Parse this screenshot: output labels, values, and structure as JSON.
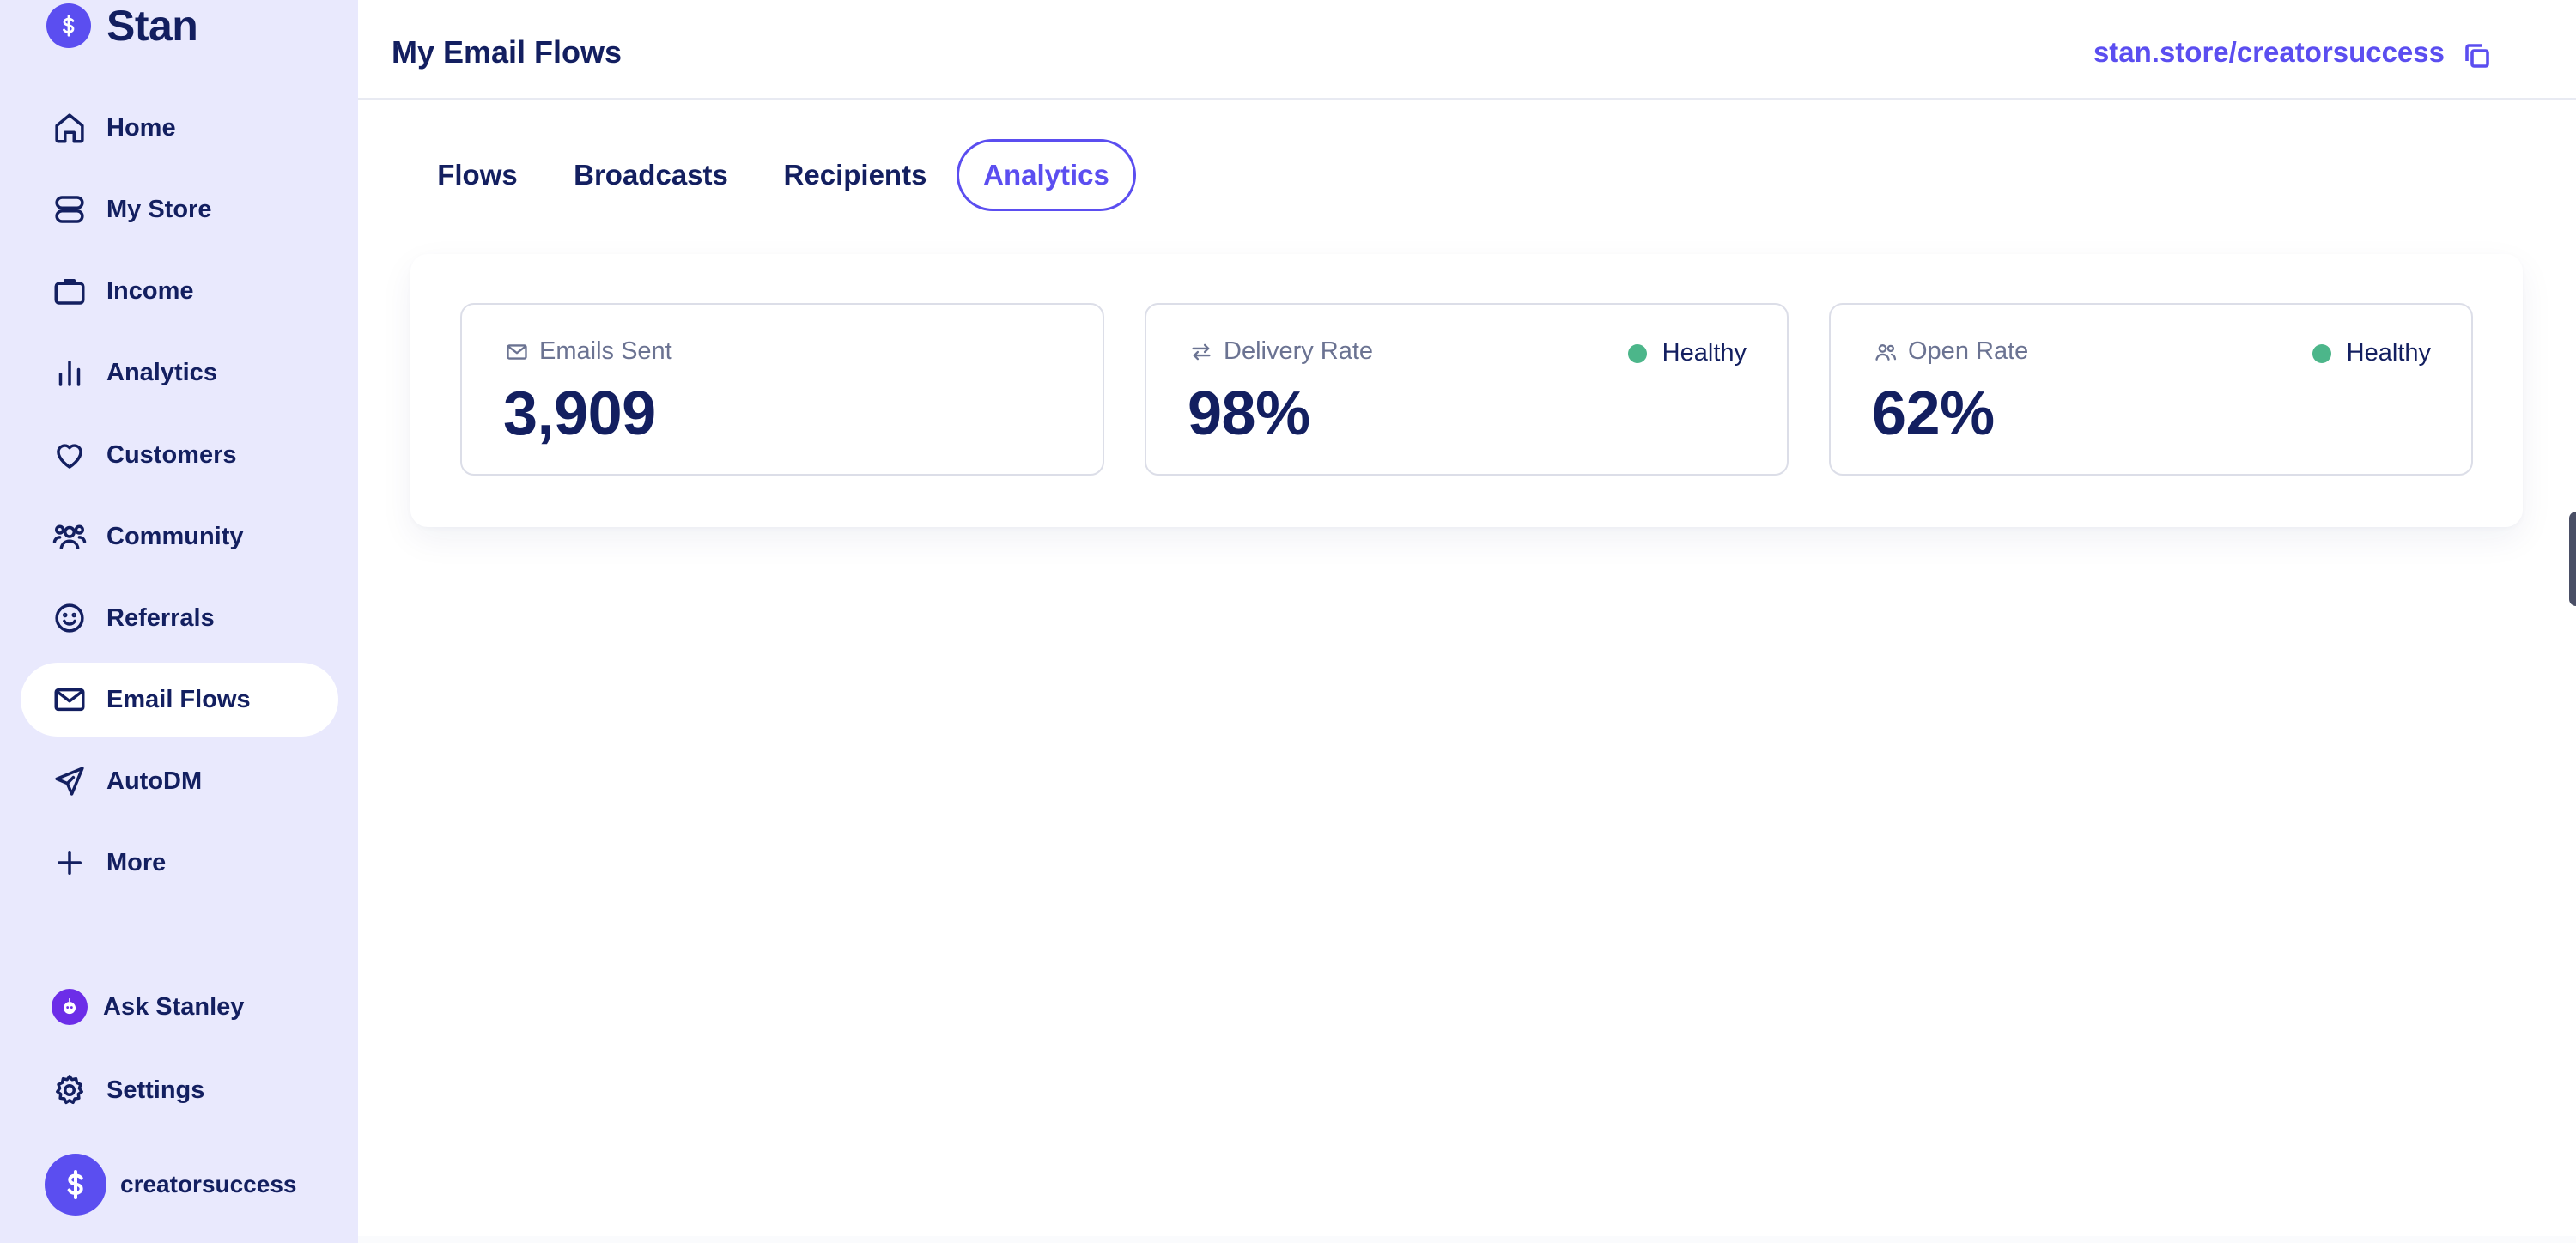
{
  "brand": {
    "name": "Stan",
    "logo_icon": "dollar-icon",
    "color": "#5b4ef0"
  },
  "sidebar": {
    "items": [
      {
        "label": "Home",
        "icon": "home-icon"
      },
      {
        "label": "My Store",
        "icon": "store-icon"
      },
      {
        "label": "Income",
        "icon": "briefcase-icon"
      },
      {
        "label": "Analytics",
        "icon": "bar-chart-icon"
      },
      {
        "label": "Customers",
        "icon": "heart-icon"
      },
      {
        "label": "Community",
        "icon": "users-icon"
      },
      {
        "label": "Referrals",
        "icon": "smile-icon"
      },
      {
        "label": "Email Flows",
        "icon": "mail-icon",
        "active": true
      },
      {
        "label": "AutoDM",
        "icon": "send-icon"
      },
      {
        "label": "More",
        "icon": "plus-icon"
      }
    ],
    "bottom": [
      {
        "label": "Ask Stanley",
        "icon": "stanley-icon"
      },
      {
        "label": "Settings",
        "icon": "gear-icon"
      }
    ],
    "profile": {
      "username": "creatorsuccess",
      "avatar_icon": "dollar-icon"
    }
  },
  "header": {
    "title": "My Email Flows",
    "store_link": "stan.store/creatorsuccess",
    "copy_icon": "copy-icon"
  },
  "tabs": [
    {
      "label": "Flows"
    },
    {
      "label": "Broadcasts"
    },
    {
      "label": "Recipients"
    },
    {
      "label": "Analytics",
      "active": true
    }
  ],
  "stats": [
    {
      "label": "Emails Sent",
      "value": "3,909",
      "icon": "mail-icon"
    },
    {
      "label": "Delivery Rate",
      "value": "98%",
      "icon": "swap-arrows-icon",
      "status": "Healthy",
      "status_color": "#4cb68a"
    },
    {
      "label": "Open Rate",
      "value": "62%",
      "icon": "users-icon",
      "status": "Healthy",
      "status_color": "#4cb68a"
    }
  ],
  "colors": {
    "accent": "#5b4ef0",
    "text": "#131f60",
    "sidebar_bg": "#e9e9fd",
    "healthy": "#4cb68a"
  }
}
